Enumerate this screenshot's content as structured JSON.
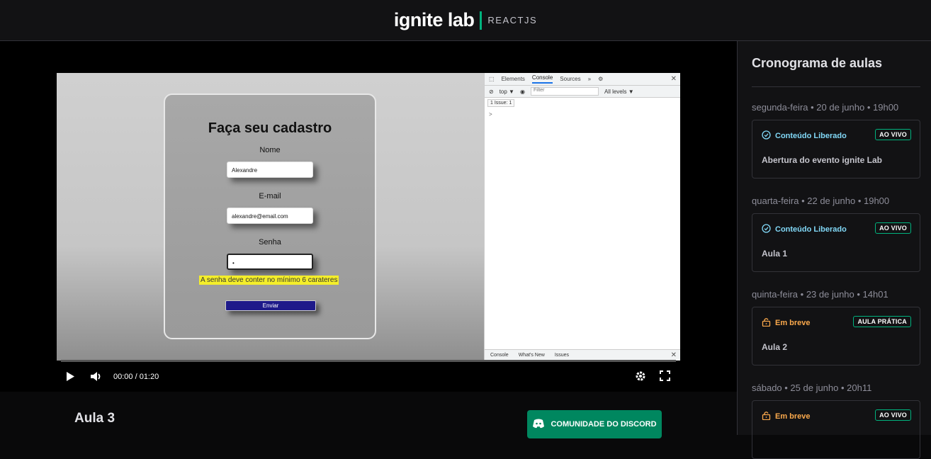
{
  "header": {
    "brand": "ignite lab",
    "product": "REACTJS"
  },
  "video": {
    "form": {
      "title": "Faça seu cadastro",
      "name_label": "Nome",
      "name_value": "Alexandre",
      "email_label": "E-mail",
      "email_value": "alexandre@email.com",
      "password_label": "Senha",
      "password_value": "•",
      "error": "A senha deve conter no mínimo 6 carateres",
      "submit": "Enviar"
    },
    "devtools": {
      "tabs": [
        "Elements",
        "Console",
        "Sources",
        "»"
      ],
      "top_select": "top ▼",
      "filter_placeholder": "Filter",
      "levels": "All levels ▼",
      "issues": "1 Issue:  1",
      "prompt": ">",
      "bottom_tabs": [
        "Console",
        "What's New",
        "Issues"
      ]
    },
    "time": "00:00 / 01:20",
    "progress": 0
  },
  "lesson_title": "Aula 3",
  "discord_button": "COMUNIDADE DO DISCORD",
  "sidebar": {
    "title": "Cronograma de aulas",
    "lessons": [
      {
        "date": "segunda-feira • 20 de junho • 19h00",
        "status": "Conteúdo Liberado",
        "badge": "AO VIVO",
        "name": "Abertura do evento ignite Lab"
      },
      {
        "date": "quarta-feira • 22 de junho • 19h00",
        "status": "Conteúdo Liberado",
        "badge": "AO VIVO",
        "name": "Aula 1"
      },
      {
        "date": "quinta-feira • 23 de junho • 14h01",
        "status": "Em breve",
        "badge": "AULA PRÁTICA",
        "name": "Aula 2"
      },
      {
        "date": "sábado • 25 de junho • 20h11",
        "status": "Em breve",
        "badge": "AO VIVO",
        "name": ""
      }
    ]
  },
  "colors": {
    "accent": "#00b37e",
    "open": "#81d8f7",
    "soon": "#fba94c",
    "discord": "#00875f"
  }
}
